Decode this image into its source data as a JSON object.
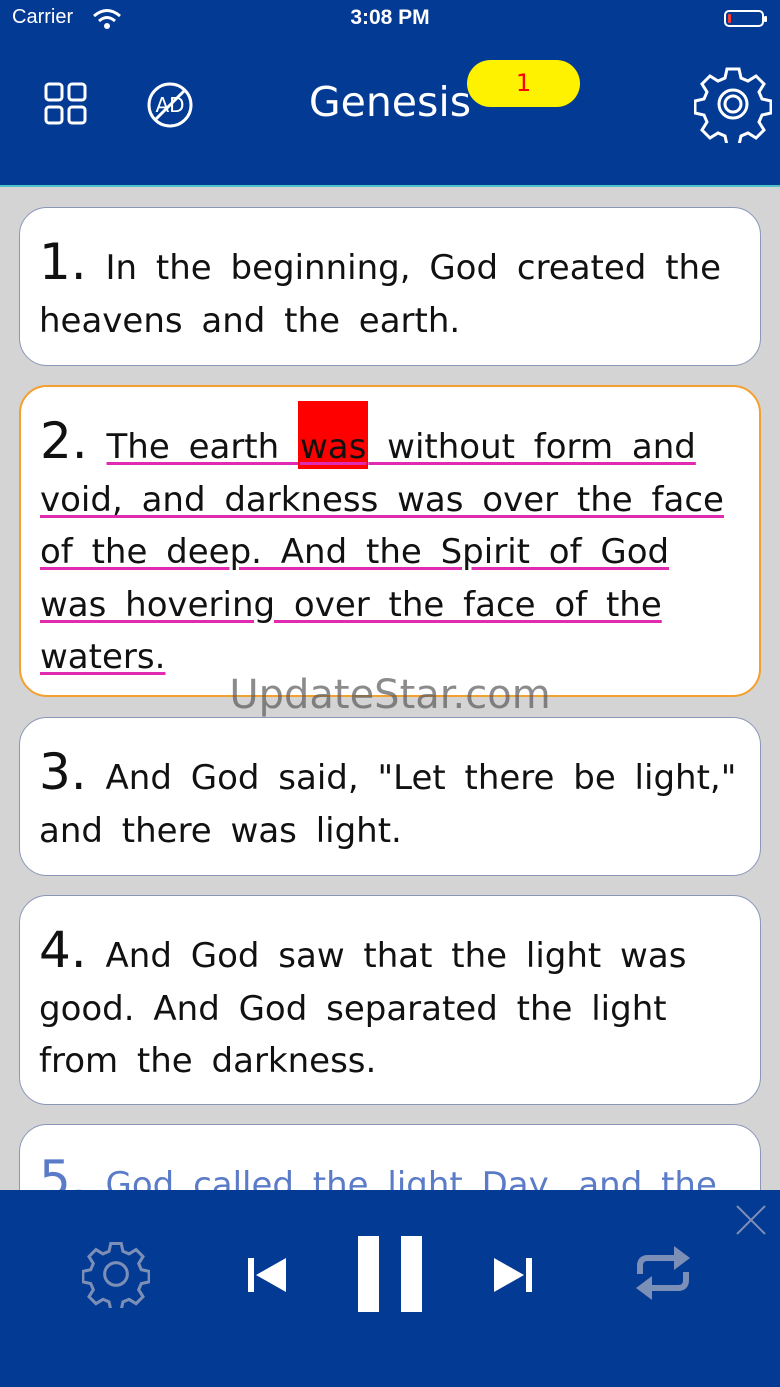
{
  "status_bar": {
    "carrier": "Carrier",
    "time": "3:08 PM"
  },
  "header": {
    "title": "Genesis",
    "badge": "1",
    "background": "#033a93",
    "badge_color": "#fff200"
  },
  "verses": [
    {
      "number": "1.",
      "text": "In the beginning, God created the heavens and the earth."
    },
    {
      "number": "2.",
      "text_before": "The earth ",
      "highlighted_word": "was",
      "text_after": " without form and void, and darkness was over the face of the deep. And the Spirit of God was hovering over the face of the waters."
    },
    {
      "number": "3.",
      "text": "And God said, \"Let there be light,\" and there was light."
    },
    {
      "number": "4.",
      "text": "And God saw that the light was good. And God separated the light from the darkness."
    },
    {
      "number": "5.",
      "text": "God called the light Day, and the"
    }
  ],
  "watermark": "UpdateStar.com",
  "icons": {
    "header_left": [
      "grid-icon",
      "no-ads-icon"
    ],
    "header_right": "gear-icon",
    "player": [
      "settings-icon",
      "previous-icon",
      "pause-icon",
      "next-icon",
      "repeat-icon",
      "close-icon"
    ]
  }
}
